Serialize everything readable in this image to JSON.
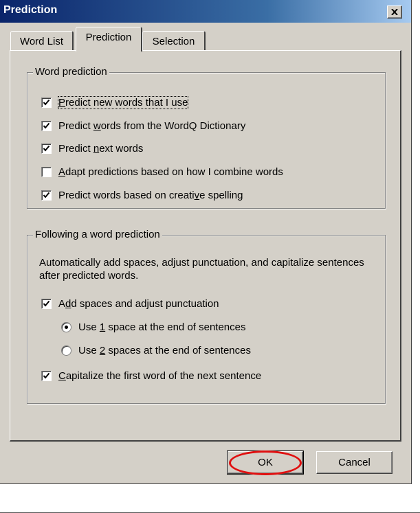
{
  "window": {
    "title": "Prediction",
    "close_symbol": "×"
  },
  "tabs": [
    {
      "label": "Word List",
      "active": false
    },
    {
      "label": "Prediction",
      "active": true
    },
    {
      "label": "Selection",
      "active": false
    }
  ],
  "word_prediction": {
    "legend": "Word prediction",
    "options": [
      {
        "pre": "",
        "mnemonic": "P",
        "post": "redict new words that I use",
        "checked": true
      },
      {
        "pre": "Predict ",
        "mnemonic": "w",
        "post": "ords from the WordQ Dictionary",
        "checked": true
      },
      {
        "pre": "Predict ",
        "mnemonic": "n",
        "post": "ext words",
        "checked": true
      },
      {
        "pre": "",
        "mnemonic": "A",
        "post": "dapt predictions based on how I combine words",
        "checked": false
      },
      {
        "pre": "Predict words based on creati",
        "mnemonic": "v",
        "post": "e spelling",
        "checked": true
      }
    ]
  },
  "following": {
    "legend": "Following a word prediction",
    "description": "Automatically add spaces, adjust punctuation, and capitalize sentences after predicted words.",
    "add_spaces": {
      "pre": "A",
      "mnemonic": "d",
      "post": "d spaces and adjust punctuation",
      "checked": true
    },
    "spacing_options": [
      {
        "pre": "Use ",
        "mnemonic": "1",
        "post": " space at the end of sentences",
        "selected": true
      },
      {
        "pre": "Use ",
        "mnemonic": "2",
        "post": " spaces at the end of sentences",
        "selected": false
      }
    ],
    "capitalize": {
      "pre": "",
      "mnemonic": "C",
      "post": "apitalize the first word of the next sentence",
      "checked": true
    }
  },
  "buttons": {
    "ok": "OK",
    "cancel": "Cancel"
  },
  "colors": {
    "titlebar_start": "#0a246a",
    "titlebar_end": "#a6caf0",
    "dialog_face": "#d4d0c8",
    "annotation": "#e01010"
  }
}
